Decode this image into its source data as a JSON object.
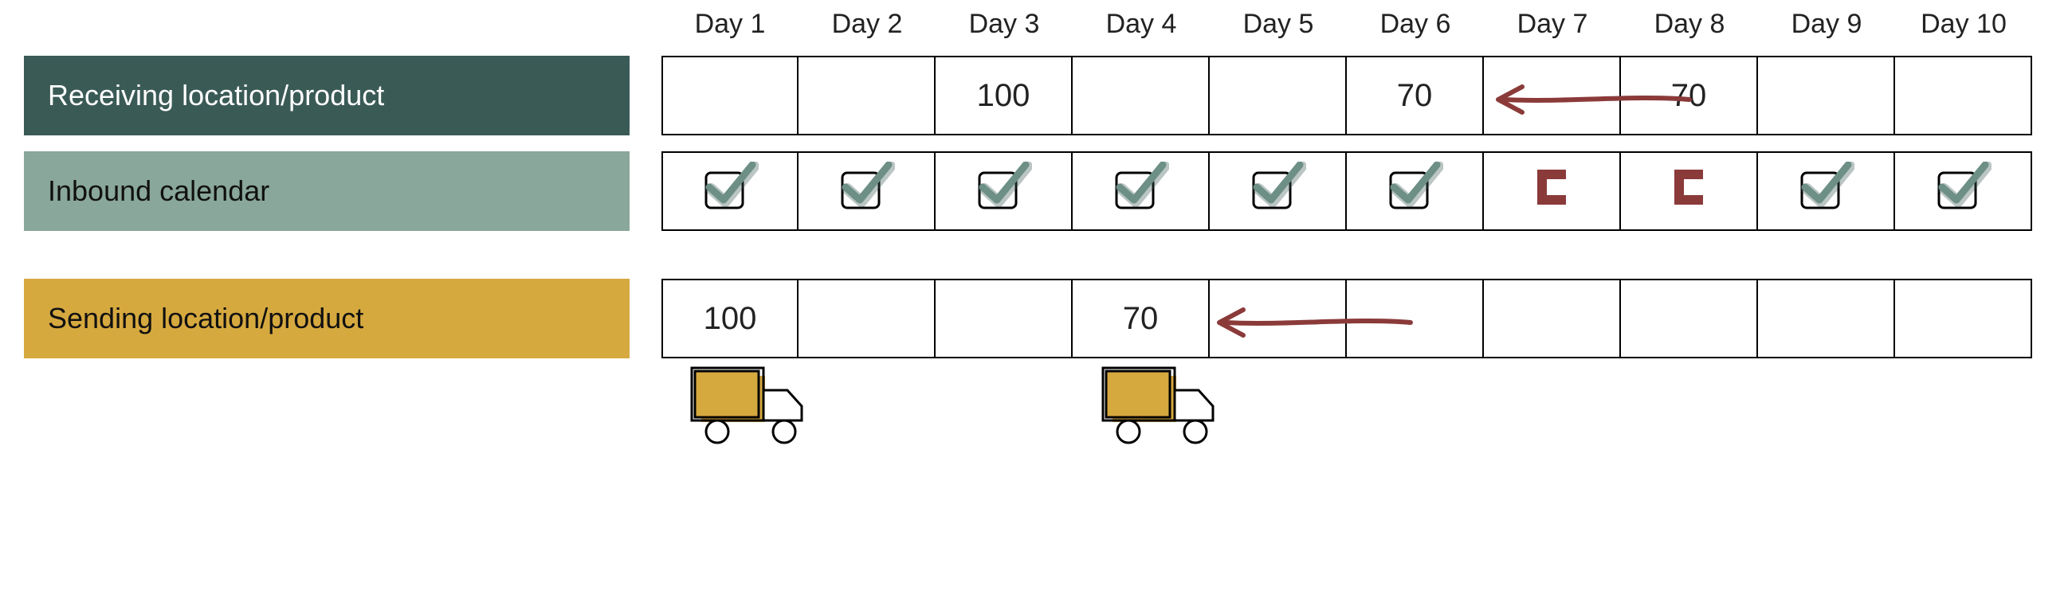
{
  "days": [
    "Day 1",
    "Day 2",
    "Day 3",
    "Day 4",
    "Day 5",
    "Day 6",
    "Day 7",
    "Day 8",
    "Day 9",
    "Day 10"
  ],
  "rows": {
    "receiving": {
      "label": "Receiving location/product",
      "values": [
        "",
        "",
        "100",
        "",
        "",
        "70",
        "",
        "70",
        "",
        ""
      ]
    },
    "inbound": {
      "label": "Inbound calendar",
      "states": [
        "ok",
        "ok",
        "ok",
        "ok",
        "ok",
        "ok",
        "blocked",
        "blocked",
        "ok",
        "ok"
      ]
    },
    "sending": {
      "label": "Sending location/product",
      "values": [
        "100",
        "",
        "",
        "70",
        "",
        "",
        "",
        "",
        "",
        ""
      ]
    }
  },
  "trucks_at_days": [
    1,
    4
  ],
  "arrows": [
    {
      "row": "receiving",
      "from_day": 8,
      "to_day": 6
    },
    {
      "row": "sending",
      "from_day": 6,
      "to_day": 4
    }
  ],
  "colors": {
    "dark_teal": "#3a5a56",
    "sage": "#89a79b",
    "sand": "#d6a93f",
    "maroon": "#8b3a3a"
  }
}
